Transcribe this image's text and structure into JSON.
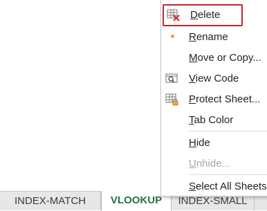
{
  "context_menu": {
    "items": [
      {
        "label_first": "D",
        "label_rest": "elete",
        "icon": "delete-sheet-icon",
        "highlighted": true
      },
      {
        "label_first": "R",
        "label_rest": "ename",
        "icon": "rename-dot-icon"
      },
      {
        "label_first": "M",
        "label_rest": "ove or Copy...",
        "icon": ""
      },
      {
        "label_first": "V",
        "label_rest": "iew Code",
        "icon": "view-code-icon"
      },
      {
        "label_first": "P",
        "label_rest": "rotect Sheet...",
        "icon": "protect-sheet-icon"
      },
      {
        "label_first": "T",
        "label_rest": "ab Color",
        "icon": ""
      },
      {
        "label_first": "H",
        "label_rest": "ide",
        "icon": ""
      },
      {
        "label_first": "U",
        "label_rest": "nhide...",
        "icon": "",
        "disabled": true
      },
      {
        "label_first": "S",
        "label_rest": "elect All Sheets",
        "icon": ""
      }
    ]
  },
  "sheet_tabs": [
    {
      "label": "INDEX-MATCH",
      "active": false
    },
    {
      "label": "VLOOKUP",
      "active": true
    },
    {
      "label": "INDEX-SMALL",
      "active": false
    }
  ],
  "colors": {
    "highlight_border": "#c0272d",
    "active_tab_text": "#217346",
    "disabled_text": "#a6a6a6"
  }
}
